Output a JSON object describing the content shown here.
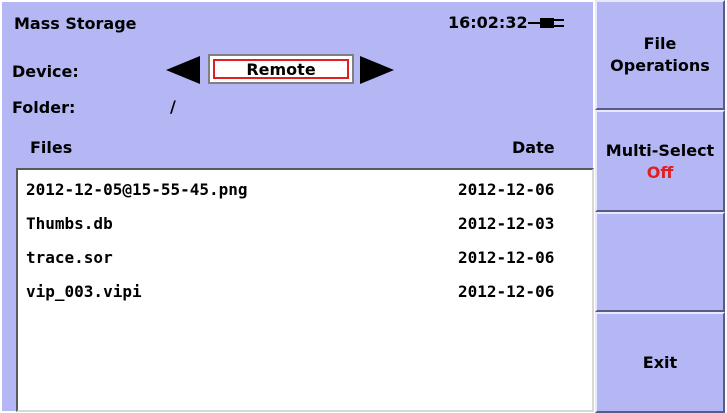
{
  "header": {
    "title": "Mass Storage",
    "time": "16:02:32",
    "power_icon": "power-plug-icon"
  },
  "device": {
    "label": "Device:",
    "value": "Remote"
  },
  "folder": {
    "label": "Folder:",
    "value": "/"
  },
  "columns": {
    "files": "Files",
    "date": "Date"
  },
  "files": [
    {
      "name": "2012-12-05@15-55-45.png",
      "date": "2012-12-06"
    },
    {
      "name": "Thumbs.db",
      "date": "2012-12-03"
    },
    {
      "name": "trace.sor",
      "date": "2012-12-06"
    },
    {
      "name": "vip_003.vipi",
      "date": "2012-12-06"
    }
  ],
  "side_buttons": {
    "file_ops_line1": "File",
    "file_ops_line2": "Operations",
    "multi_select": "Multi-Select",
    "multi_select_state": "Off",
    "blank": "",
    "exit": "Exit"
  },
  "colors": {
    "panel": "#b4b7f3",
    "state_off": "#e02020",
    "list_bg": "#ffffff"
  }
}
